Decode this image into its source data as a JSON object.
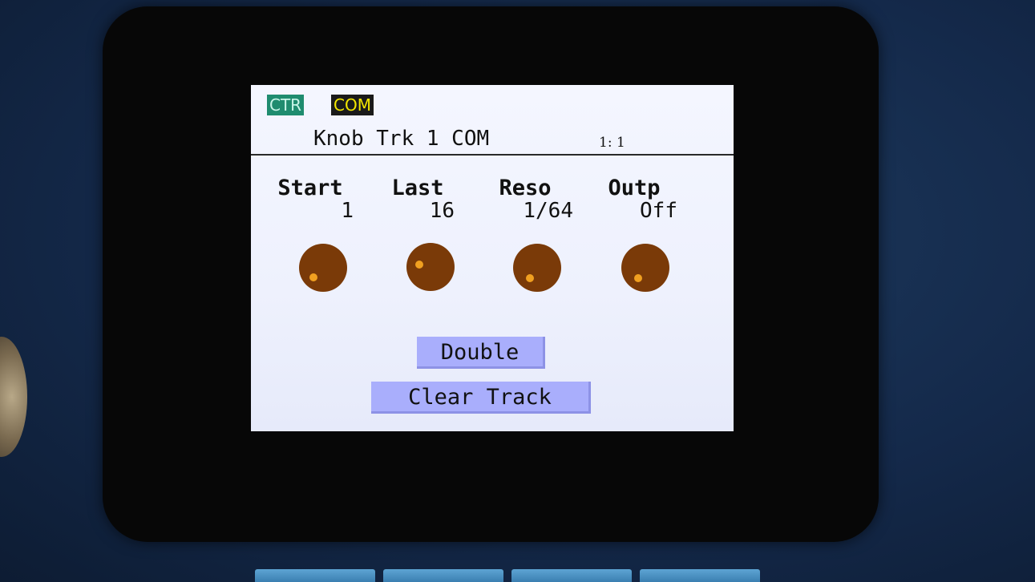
{
  "tags": {
    "ctr": "CTR",
    "com": "COM"
  },
  "header": {
    "title": "Knob Trk 1 COM",
    "position": "1: 1"
  },
  "params": [
    {
      "label": "Start",
      "value": "1"
    },
    {
      "label": "Last",
      "value": "16"
    },
    {
      "label": "Reso",
      "value": "1/64"
    },
    {
      "label": "Outp",
      "value": "Off"
    }
  ],
  "buttons": {
    "double": "Double",
    "clear_track": "Clear Track"
  },
  "colors": {
    "ctr_tag_bg": "#1f8c6f",
    "com_tag_bg": "#1a1a1a",
    "com_tag_text": "#f2e600",
    "knob": "#7a3a08",
    "knob_indicator": "#f0a020",
    "button_bg": "#a9aefc"
  }
}
